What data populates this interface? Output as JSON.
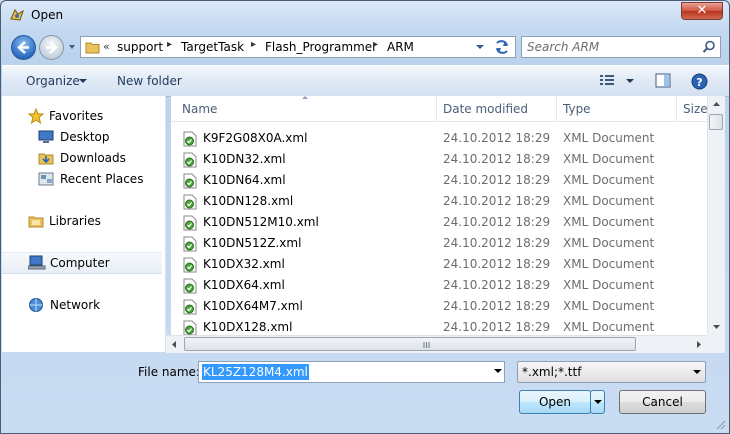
{
  "window": {
    "title": "Open"
  },
  "nav": {
    "chevron": "«",
    "breadcrumbs": [
      "support",
      "TargetTask",
      "Flash_Programmer",
      "ARM"
    ]
  },
  "search": {
    "placeholder": "Search ARM"
  },
  "toolbar": {
    "organize_label": "Organize",
    "new_folder_label": "New folder"
  },
  "sidebar": {
    "items": [
      {
        "label": "Favorites",
        "icon": "star-icon"
      },
      {
        "label": "Desktop",
        "icon": "desktop-icon"
      },
      {
        "label": "Downloads",
        "icon": "downloads-icon"
      },
      {
        "label": "Recent Places",
        "icon": "recent-places-icon"
      },
      {
        "label": "Libraries",
        "icon": "libraries-icon"
      },
      {
        "label": "Computer",
        "icon": "computer-icon"
      },
      {
        "label": "Network",
        "icon": "network-icon"
      }
    ]
  },
  "file_list": {
    "columns": [
      "Name",
      "Date modified",
      "Type",
      "Size"
    ],
    "rows": [
      {
        "name": "K9F2G08X0A.xml",
        "date": "24.10.2012 18:29",
        "type": "XML Document"
      },
      {
        "name": "K10DN32.xml",
        "date": "24.10.2012 18:29",
        "type": "XML Document"
      },
      {
        "name": "K10DN64.xml",
        "date": "24.10.2012 18:29",
        "type": "XML Document"
      },
      {
        "name": "K10DN128.xml",
        "date": "24.10.2012 18:29",
        "type": "XML Document"
      },
      {
        "name": "K10DN512M10.xml",
        "date": "24.10.2012 18:29",
        "type": "XML Document"
      },
      {
        "name": "K10DN512Z.xml",
        "date": "24.10.2012 18:29",
        "type": "XML Document"
      },
      {
        "name": "K10DX32.xml",
        "date": "24.10.2012 18:29",
        "type": "XML Document"
      },
      {
        "name": "K10DX64.xml",
        "date": "24.10.2012 18:29",
        "type": "XML Document"
      },
      {
        "name": "K10DX64M7.xml",
        "date": "24.10.2012 18:29",
        "type": "XML Document"
      },
      {
        "name": "K10DX128.xml",
        "date": "24.10.2012 18:29",
        "type": "XML Document"
      }
    ]
  },
  "bottom": {
    "file_name_label": "File name:",
    "file_name_value": "KL25Z128M4.xml",
    "file_type_value": "*.xml;*.ttf",
    "open_label": "Open",
    "cancel_label": "Cancel"
  },
  "colors": {
    "selection": "#3399ff",
    "title_close": "#c7402c",
    "toolbar_text": "#1e395b"
  }
}
